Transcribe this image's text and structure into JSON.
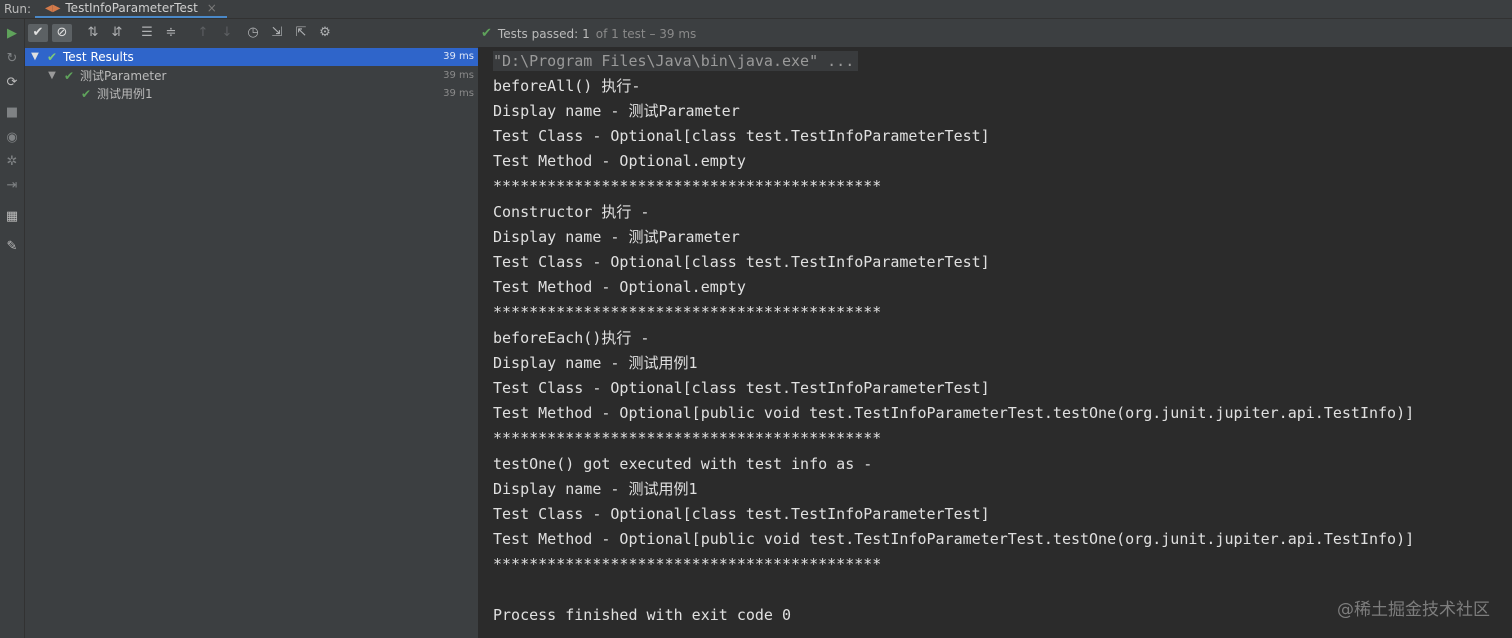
{
  "topbar": {
    "run_label": "Run:",
    "tab_title": "TestInfoParameterTest",
    "tab_close": "×"
  },
  "toolbar": {
    "status_prefix": "Tests passed:",
    "status_count": "1",
    "status_suffix": "of 1 test – 39 ms"
  },
  "tree": {
    "rows": [
      {
        "label": "Test Results",
        "time": "39 ms"
      },
      {
        "label": "测试Parameter",
        "time": "39 ms"
      },
      {
        "label": "测试用例1",
        "time": "39 ms"
      }
    ]
  },
  "console": {
    "lines": [
      "\"D:\\Program Files\\Java\\bin\\java.exe\" ...",
      "beforeAll() 执行-",
      "Display name - 测试Parameter",
      "Test Class - Optional[class test.TestInfoParameterTest]",
      "Test Method - Optional.empty",
      "*******************************************",
      "Constructor 执行 -",
      "Display name - 测试Parameter",
      "Test Class - Optional[class test.TestInfoParameterTest]",
      "Test Method - Optional.empty",
      "*******************************************",
      "beforeEach()执行 -",
      "Display name - 测试用例1",
      "Test Class - Optional[class test.TestInfoParameterTest]",
      "Test Method - Optional[public void test.TestInfoParameterTest.testOne(org.junit.jupiter.api.TestInfo)]",
      "*******************************************",
      "testOne() got executed with test info as -",
      "Display name - 测试用例1",
      "Test Class - Optional[class test.TestInfoParameterTest]",
      "Test Method - Optional[public void test.TestInfoParameterTest.testOne(org.junit.jupiter.api.TestInfo)]",
      "*******************************************",
      "",
      "Process finished with exit code 0"
    ]
  },
  "watermark": "@稀土掘金技术社区",
  "colors": {
    "accent": "#2f65ca",
    "pass": "#5fa35b",
    "console_bg": "#2b2b2b",
    "panel_bg": "#3c3f41"
  }
}
